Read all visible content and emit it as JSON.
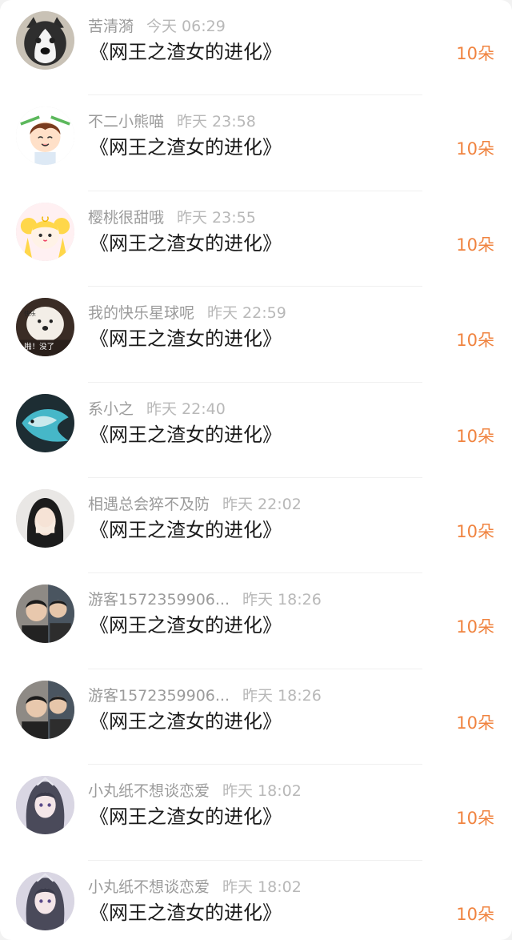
{
  "rows": [
    {
      "name": "苦清漪",
      "time": "今天 06:29",
      "title": "《网王之渣女的进化》",
      "count": "10朵",
      "avatar": "husky-dog"
    },
    {
      "name": "不二小熊喵",
      "time": "昨天 23:58",
      "title": "《网王之渣女的进化》",
      "count": "10朵",
      "avatar": "cartoon-boy"
    },
    {
      "name": "樱桃很甜哦",
      "time": "昨天 23:55",
      "title": "《网王之渣女的进化》",
      "count": "10朵",
      "avatar": "sailor-moon-girl"
    },
    {
      "name": "我的快乐星球呢",
      "time": "昨天 22:59",
      "title": "《网王之渣女的进化》",
      "count": "10朵",
      "avatar": "dog-meme"
    },
    {
      "name": "系小之",
      "time": "昨天 22:40",
      "title": "《网王之渣女的进化》",
      "count": "10朵",
      "avatar": "betta-fish"
    },
    {
      "name": "相遇总会猝不及防",
      "time": "昨天 22:02",
      "title": "《网王之渣女的进化》",
      "count": "10朵",
      "avatar": "girl-covering-face"
    },
    {
      "name": "游客1572359906...",
      "time": "昨天 18:26",
      "title": "《网王之渣女的进化》",
      "count": "10朵",
      "avatar": "two-men-photo"
    },
    {
      "name": "游客1572359906...",
      "time": "昨天 18:26",
      "title": "《网王之渣女的进化》",
      "count": "10朵",
      "avatar": "two-men-photo"
    },
    {
      "name": "小丸纸不想谈恋爱",
      "time": "昨天 18:02",
      "title": "《网王之渣女的进化》",
      "count": "10朵",
      "avatar": "anime-girl"
    },
    {
      "name": "小丸纸不想谈恋爱",
      "time": "昨天 18:02",
      "title": "《网王之渣女的进化》",
      "count": "10朵",
      "avatar": "anime-girl"
    }
  ],
  "dog_meme_text": "快乐\n啪！没了"
}
